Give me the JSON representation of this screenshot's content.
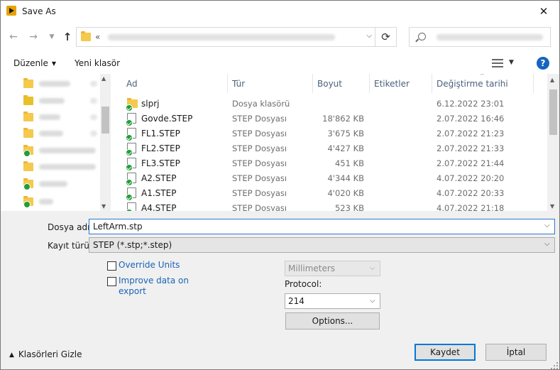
{
  "window": {
    "title": "Save As",
    "close": "✕"
  },
  "address": {
    "prefix": "«",
    "refresh": "⟳"
  },
  "toolbar": {
    "organize": "Düzenle",
    "new_folder": "Yeni klasör",
    "help": "?"
  },
  "columns": {
    "name": "Ad",
    "type": "Tür",
    "size": "Boyut",
    "tags": "Etiketler",
    "modified": "Değiştirme tarihi"
  },
  "files": [
    {
      "name": "slprj",
      "type": "Dosya klasörü",
      "size": "",
      "date": "6.12.2022 23:01",
      "folder": true
    },
    {
      "name": "Govde.STEP",
      "type": "STEP Dosyası",
      "size": "18'862 KB",
      "date": "2.07.2022 16:46"
    },
    {
      "name": "FL1.STEP",
      "type": "STEP Dosyası",
      "size": "3'675 KB",
      "date": "2.07.2022 21:23"
    },
    {
      "name": "FL2.STEP",
      "type": "STEP Dosyası",
      "size": "4'427 KB",
      "date": "2.07.2022 21:33"
    },
    {
      "name": "FL3.STEP",
      "type": "STEP Dosyası",
      "size": "451 KB",
      "date": "2.07.2022 21:44"
    },
    {
      "name": "A2.STEP",
      "type": "STEP Dosyası",
      "size": "4'344 KB",
      "date": "4.07.2022 20:20"
    },
    {
      "name": "A1.STEP",
      "type": "STEP Dosyası",
      "size": "4'020 KB",
      "date": "4.07.2022 20:33"
    },
    {
      "name": "A4.STEP",
      "type": "STEP Dosyası",
      "size": "523 KB",
      "date": "4.07.2022 21:18"
    }
  ],
  "form": {
    "filename_label": "Dosya adı:",
    "filename_value": "LeftArm.stp",
    "filetype_label": "Kayıt türü:",
    "filetype_value": "STEP (*.stp;*.step)",
    "override_units": "Override Units",
    "improve_data": "Improve data on export",
    "units_value": "Millimeters",
    "protocol_label": "Protocol:",
    "protocol_value": "214",
    "options_button": "Options...",
    "hide_folders": "Klasörleri Gizle",
    "save_button": "Kaydet",
    "cancel_button": "İptal"
  },
  "colors": {
    "accent": "#0078d7",
    "link": "#1a64b8",
    "help": "#1664c0",
    "sync_ok": "#1f9e3a"
  }
}
